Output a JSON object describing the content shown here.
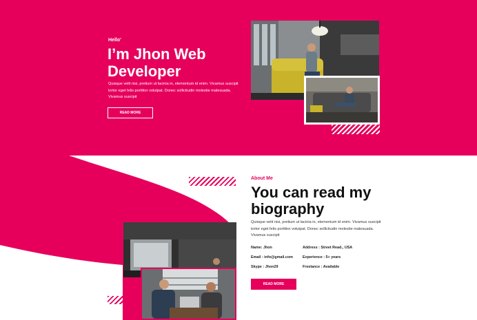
{
  "colors": {
    "accent": "#e6005c",
    "white": "#ffffff",
    "text": "#111111"
  },
  "hero": {
    "greeting": "Hello'",
    "title": "I’m Jhon Web Developer",
    "description": "Quisque velit nisi, pretium ut lacinia in, elementum id enim. Vivamus suscipit tortor eget felis porttitor volutpat. Donec sollicitudin molestie malesuada. Vivamus suscipit",
    "button_label": "READ MORE"
  },
  "about": {
    "label": "About Me",
    "title": "You can read my biography",
    "description": "Quisque velit nisi, pretium ut lacinia in, elementum id enim. Vivamus suscipit tortor eget felis porttitor volutpat. Donec sollicitudin molestie malesuada. Vivamus suscipit",
    "info": {
      "name": "Name: Jhon",
      "address": "Address : Street Read., USA",
      "email": "Email : info@gmail.com",
      "experience": "Experience : 5+ years",
      "skype": "Skype : Jhon29",
      "freelance": "Freelance : Available"
    },
    "button_label": "READ MORE"
  }
}
